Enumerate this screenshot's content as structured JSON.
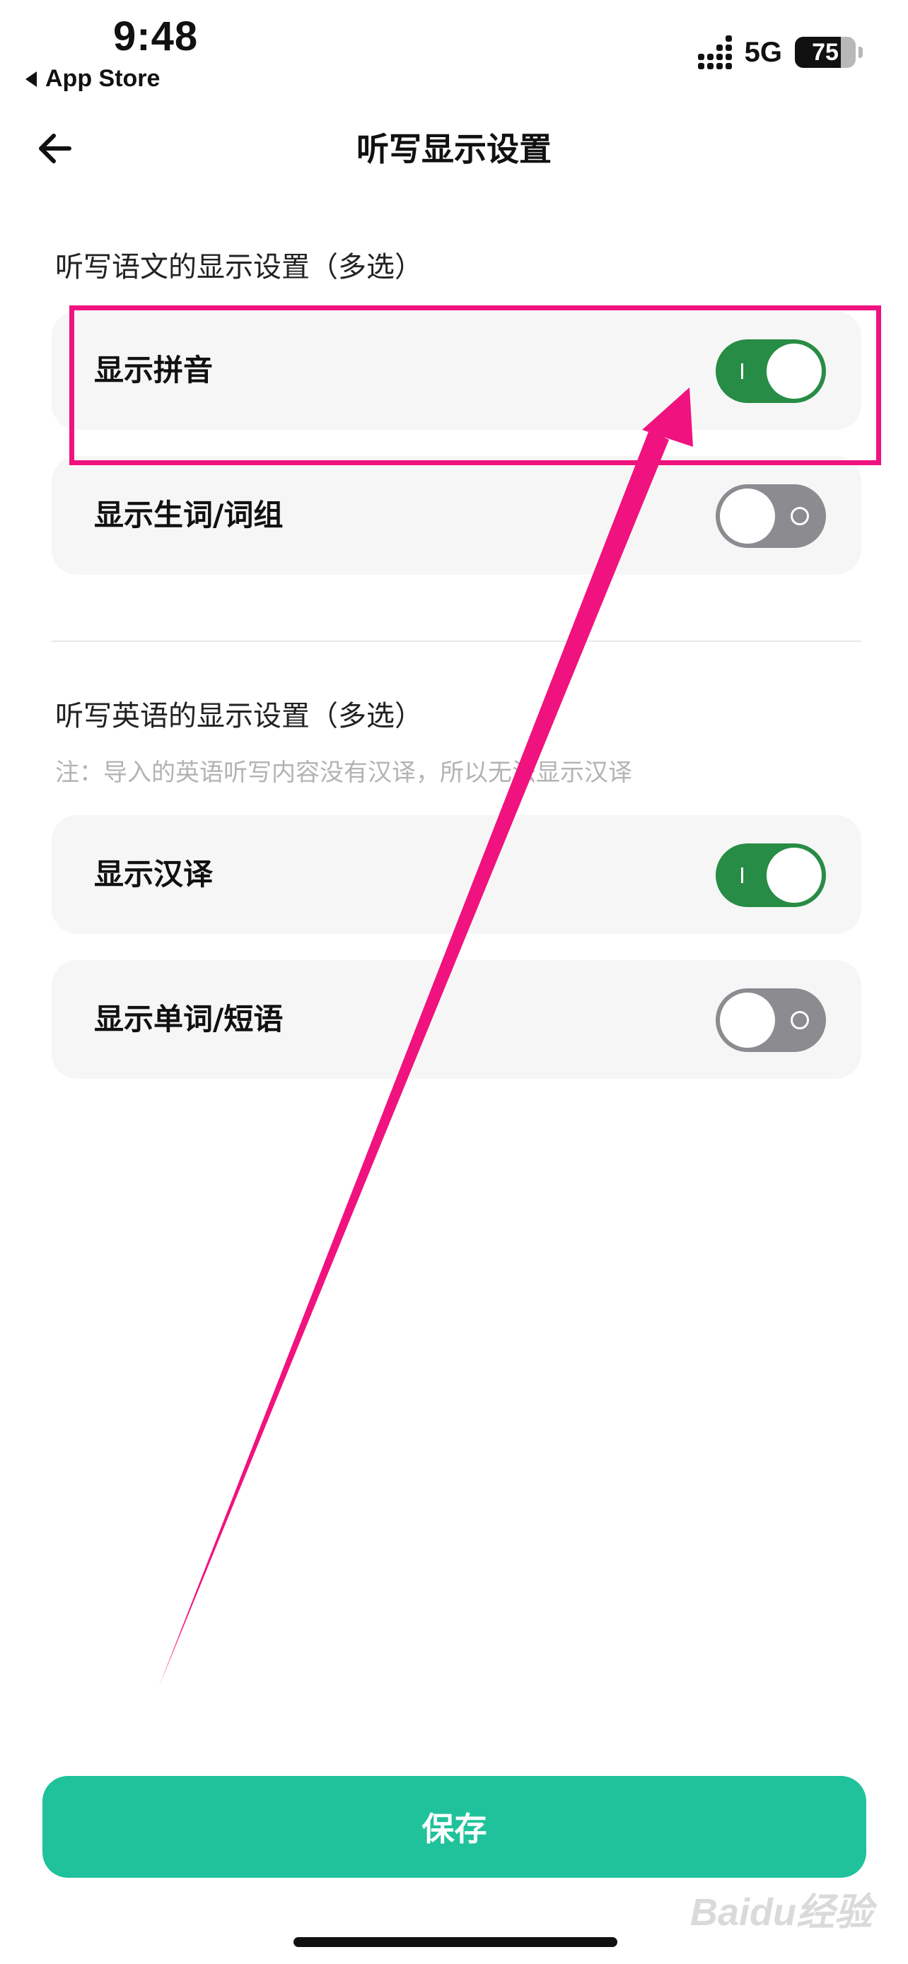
{
  "status_bar": {
    "time": "9:48",
    "back_app": "App Store",
    "network": "5G",
    "battery": "75",
    "battery_level": 0.75
  },
  "header": {
    "title": "听写显示设置"
  },
  "chinese_section": {
    "title": "听写语文的显示设置（多选）",
    "options": [
      {
        "label": "显示拼音",
        "enabled": true
      },
      {
        "label": "显示生词/词组",
        "enabled": false
      }
    ]
  },
  "english_section": {
    "title": "听写英语的显示设置（多选）",
    "note": "注：导入的英语听写内容没有汉译，所以无法显示汉译",
    "options": [
      {
        "label": "显示汉译",
        "enabled": true
      },
      {
        "label": "显示单词/短语",
        "enabled": false
      }
    ]
  },
  "save_button": "保存",
  "watermark": "Baidu经验",
  "annotation_color": "#f0127e",
  "accent_color": "#1fc29a",
  "switch_on_color": "#278c45"
}
